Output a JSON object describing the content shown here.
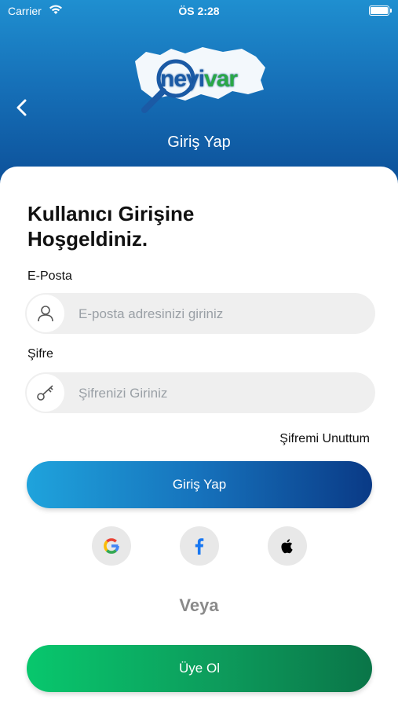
{
  "status_bar": {
    "carrier": "Carrier",
    "time": "ÖS 2:28"
  },
  "header": {
    "title": "Giriş Yap",
    "logo_text_ne": "ne",
    "logo_text_yi": "yi",
    "logo_text_var": "var"
  },
  "welcome": "Kullanıcı Girişine Hoşgeldiniz.",
  "email": {
    "label": "E-Posta",
    "placeholder": "E-posta adresinizi giriniz",
    "value": ""
  },
  "password": {
    "label": "Şifre",
    "placeholder": "Şifrenizi Giriniz",
    "value": ""
  },
  "forgot_password": "Şifremi Unuttum",
  "login_button": "Giriş Yap",
  "social": [
    {
      "name": "google-icon"
    },
    {
      "name": "facebook-icon"
    },
    {
      "name": "apple-icon"
    }
  ],
  "or_text": "Veya",
  "register_button": "Üye Ol",
  "colors": {
    "header_top": "#1f8fd0",
    "header_bottom": "#0c4f98",
    "login_gradient_start": "#1fa3dc",
    "login_gradient_end": "#0a3a86",
    "register_gradient_start": "#08c76d",
    "register_gradient_end": "#0a7548"
  }
}
